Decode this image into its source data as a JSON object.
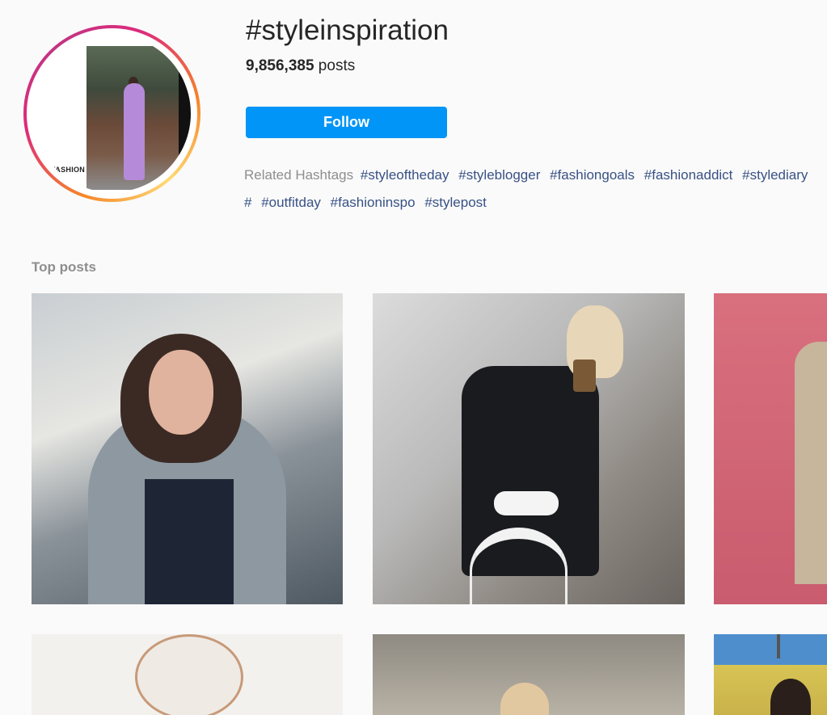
{
  "header": {
    "title": "#styleinspiration",
    "post_count": "9,856,385",
    "post_count_suffix": " posts",
    "follow_label": "Follow",
    "avatar_text": "FASHION"
  },
  "related": {
    "label": "Related Hashtags",
    "tags": [
      "#styleoftheday",
      "#styleblogger",
      "#fashiongoals",
      "#fashionaddict",
      "#stylediary",
      "#",
      "#outfitday",
      "#fashioninspo",
      "#stylepost"
    ]
  },
  "sections": {
    "top_posts_label": "Top posts"
  },
  "colors": {
    "accent": "#0095f6",
    "tag_link": "#385185",
    "muted_text": "#8e8e8e",
    "background": "#fafafa"
  }
}
